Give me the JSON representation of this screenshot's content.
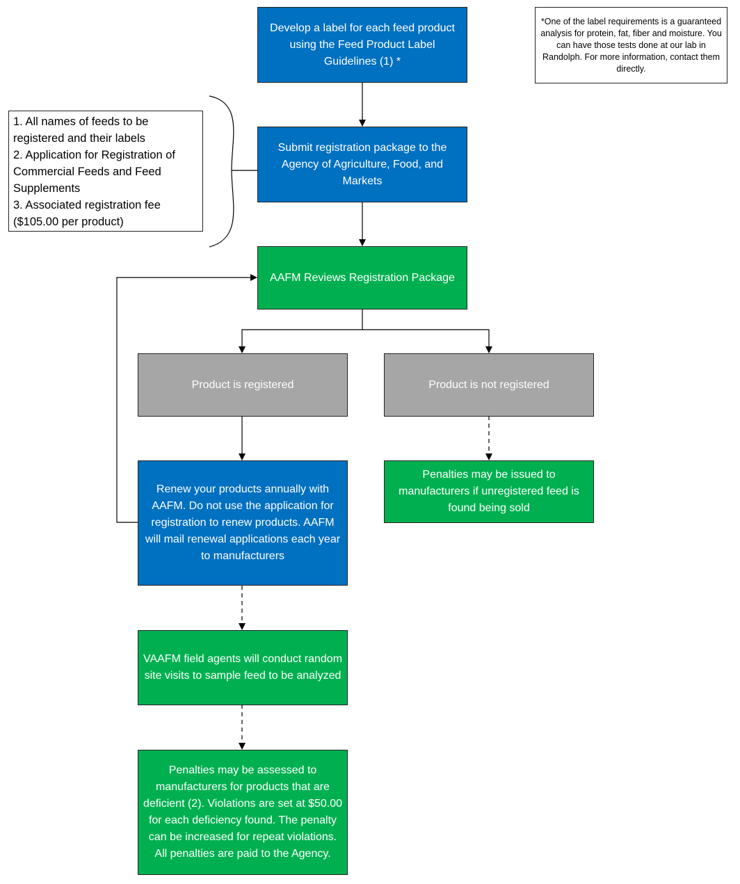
{
  "diagram": {
    "nodes": {
      "develop_label": "Develop a label for each feed product using the Feed Product Label Guidelines (1) *",
      "submit_package": "Submit registration package to the Agency of Agriculture, Food, and Markets",
      "aafm_reviews": "AAFM Reviews Registration Package",
      "registered": "Product is registered",
      "not_registered": "Product is not registered",
      "renew": "Renew your products annually with AAFM. Do not use the application for registration to renew products. AAFM will mail renewal applications each year to manufacturers",
      "penalties_unregistered": "Penalties may be issued to manufacturers if unregistered feed is found being sold",
      "field_agents": "VAAFM field agents will conduct random site visits to sample feed to be analyzed",
      "penalties_deficient": "Penalties may be assessed to manufacturers for products that are deficient (2). Violations are set at $50.00 for each deficiency found. The penalty can be increased for repeat violations. All penalties are paid to the Agency."
    },
    "footnote": "*One of the label requirements is a guaranteed analysis for protein, fat, fiber and moisture. You can have those tests done at our lab in Randolph. For more information, contact them directly.",
    "package_contents": [
      "1. All names of feeds to be registered and their labels",
      "2. Application for Registration of Commercial Feeds and Feed Supplements",
      "3. Associated registration fee ($105.00 per product)"
    ],
    "colors": {
      "blue": "#0070C0",
      "green": "#00B050",
      "gray": "#A6A6A6"
    }
  }
}
